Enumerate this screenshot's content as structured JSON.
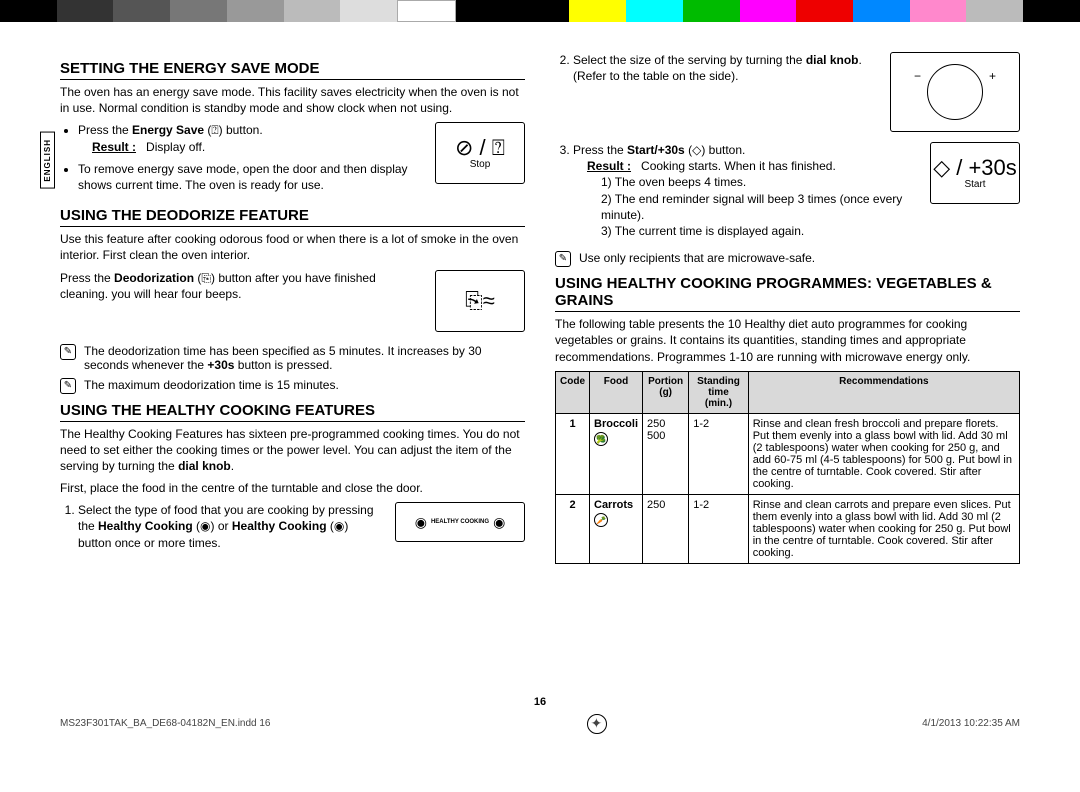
{
  "color_bar": [
    "#000",
    "#333",
    "#555",
    "#777",
    "#999",
    "#bbb",
    "#ddd",
    "#fff",
    "#000",
    "#000",
    "#ff0",
    "#0ff",
    "#0b0",
    "#f0f",
    "#e00",
    "#08f",
    "#f8c",
    "#bbb",
    "#000"
  ],
  "lang_tab": "ENGLISH",
  "s1": {
    "title": "SETTING THE ENERGY SAVE MODE",
    "intro": "The oven has an energy save mode. This facility saves electricity when the oven is not in use. Normal condition is standby mode and show clock when not using.",
    "li1_a": "Press the ",
    "li1_b": "Energy Save",
    "li1_c": " (",
    "li1_d": ") button.",
    "result_lbl": "Result :",
    "result_val": "Display off.",
    "li2": "To remove energy save mode, open the door and then display shows current time. The oven is ready for use.",
    "box_label": "Stop"
  },
  "s2": {
    "title": "USING THE DEODORIZE FEATURE",
    "intro": "Use this feature after cooking odorous food or when there is a lot of smoke in the oven interior. First clean the oven interior.",
    "p2_a": "Press the ",
    "p2_b": "Deodorization",
    "p2_c": " (",
    "p2_d": ") button after you have finished cleaning. you will hear four beeps.",
    "note1_a": "The deodorization time has been specified as 5 minutes. It increases by 30 seconds whenever the ",
    "note1_b": "+30s",
    "note1_c": " button is pressed.",
    "note2": "The maximum deodorization time is 15 minutes."
  },
  "s3": {
    "title": "USING THE HEALTHY COOKING FEATURES",
    "intro_a": "The Healthy Cooking Features has sixteen pre-programmed cooking times. You do not need to set either the cooking times or the power level. You can adjust the item of the serving by turning the ",
    "intro_b": "dial knob",
    "intro_c": ".",
    "first": "First, place the food in the centre of the turntable and close the door.",
    "li1_a": "Select the type of food that you are cooking by pressing the ",
    "li1_b": "Healthy Cooking",
    "li1_c": " (",
    "li1_d": ") or ",
    "li1_e": "Healthy Cooking",
    "li1_f": " (",
    "li1_g": ") button once or more times.",
    "li2_a": "Select the size of the serving by turning the ",
    "li2_b": "dial knob",
    "li2_c": ". (Refer to the table on the side).",
    "box_hc": "HEALTHY COOKING"
  },
  "s3b": {
    "li3_a": "Press the ",
    "li3_b": "Start/+30s",
    "li3_c": " (",
    "li3_d": ") button.",
    "result_lbl": "Result :",
    "result_val": "Cooking starts. When it has finished.",
    "r1": "The oven beeps 4 times.",
    "r2": "The end reminder signal will beep 3 times (once every minute).",
    "r3": "The current time is displayed again.",
    "note": "Use only recipients that are microwave-safe.",
    "box_label": "Start",
    "box_glyph": "◇ / +30s"
  },
  "s4": {
    "title": "USING HEALTHY COOKING PROGRAMMES: VEGETABLES & GRAINS",
    "intro": "The following table presents the 10 Healthy diet auto programmes for cooking vegetables or grains. It contains its quantities, standing times and appropriate recommendations. Programmes 1-10 are running with microwave energy only.",
    "th_code": "Code",
    "th_food": "Food",
    "th_portion": "Portion (g)",
    "th_stand": "Standing time (min.)",
    "th_rec": "Recommendations",
    "chart_data": {
      "type": "table",
      "rows": [
        {
          "code": "1",
          "food": "Broccoli",
          "portion": "250\n500",
          "stand": "1-2",
          "rec": "Rinse and clean fresh broccoli and prepare florets. Put them evenly into a glass bowl with lid. Add 30 ml (2 tablespoons) water when cooking for 250 g, and add 60-75 ml (4-5 tablespoons) for 500 g. Put bowl in the centre of turntable. Cook covered. Stir after cooking."
        },
        {
          "code": "2",
          "food": "Carrots",
          "portion": "250",
          "stand": "1-2",
          "rec": "Rinse and clean carrots and prepare even slices. Put them evenly into a glass bowl with lid. Add 30 ml (2 tablespoons) water when cooking for 250 g. Put bowl in the centre of turntable. Cook covered. Stir after cooking."
        }
      ]
    }
  },
  "page_num": "16",
  "footer_left": "MS23F301TAK_BA_DE68-04182N_EN.indd   16",
  "footer_right": "4/1/2013   10:22:35 AM"
}
